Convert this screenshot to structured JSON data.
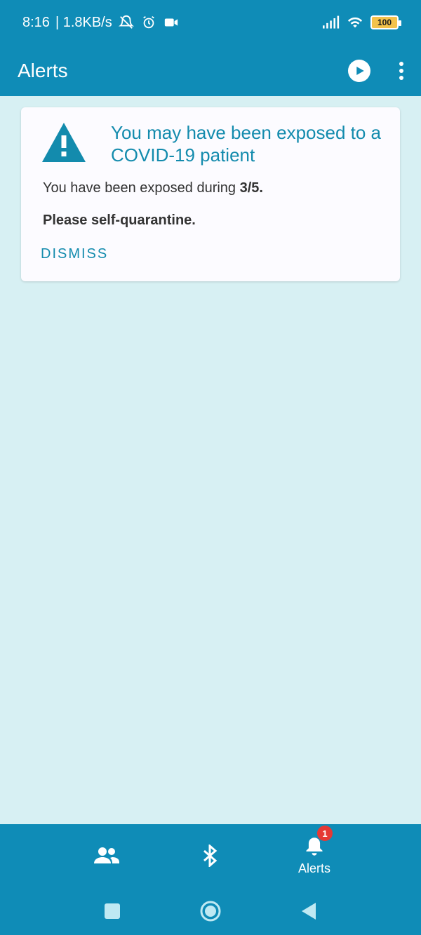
{
  "status_bar": {
    "time": "8:16",
    "network_speed": "| 1.8KB/s",
    "battery": "100",
    "icons": [
      "mute-bell-icon",
      "alarm-icon",
      "video-icon",
      "signal-icon",
      "wifi-icon",
      "battery-icon"
    ]
  },
  "app_bar": {
    "title": "Alerts",
    "actions": [
      "play-icon",
      "more-vert-icon"
    ]
  },
  "card": {
    "title": "You may have been exposed to a COVID-19 patient",
    "text_prefix": "You have been exposed during ",
    "text_value": "3/5.",
    "strong_text": "Please self-quarantine.",
    "dismiss_label": "DISMISS",
    "icon": "warning-icon"
  },
  "bottom_nav": {
    "items": [
      {
        "icon": "people-icon",
        "label": ""
      },
      {
        "icon": "bluetooth-icon",
        "label": ""
      },
      {
        "icon": "bell-icon",
        "label": "Alerts",
        "badge": "1"
      }
    ]
  },
  "system_nav": {
    "buttons": [
      "square-icon",
      "circle-icon",
      "back-triangle-icon"
    ]
  },
  "colors": {
    "primary": "#0f8cb7",
    "background": "#d7f0f3",
    "card": "#fcfbff",
    "accent_text": "#138bad",
    "badge": "#e53935"
  }
}
